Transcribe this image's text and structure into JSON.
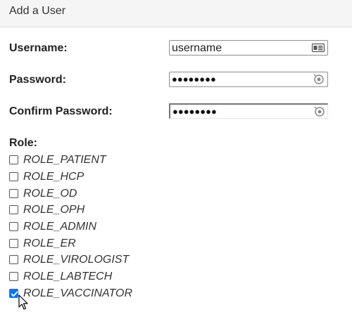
{
  "header": {
    "title": "Add a User"
  },
  "form": {
    "username": {
      "label": "Username:",
      "value": "username",
      "icon": "contact-card-icon"
    },
    "password": {
      "label": "Password:",
      "masked_value": "●●●●●●●●",
      "icon": "password-reveal-icon"
    },
    "confirm_password": {
      "label": "Confirm Password:",
      "masked_value": "●●●●●●●●",
      "icon": "password-reveal-icon"
    }
  },
  "roles": {
    "label": "Role:",
    "items": [
      {
        "label": "ROLE_PATIENT",
        "checked": false
      },
      {
        "label": "ROLE_HCP",
        "checked": false
      },
      {
        "label": "ROLE_OD",
        "checked": false
      },
      {
        "label": "ROLE_OPH",
        "checked": false
      },
      {
        "label": "ROLE_ADMIN",
        "checked": false
      },
      {
        "label": "ROLE_ER",
        "checked": false
      },
      {
        "label": "ROLE_VIROLOGIST",
        "checked": false
      },
      {
        "label": "ROLE_LABTECH",
        "checked": false
      },
      {
        "label": "ROLE_VACCINATOR",
        "checked": true
      }
    ]
  },
  "colors": {
    "checkbox_checked": "#0075ff",
    "header_bg": "#f5f5f5"
  }
}
